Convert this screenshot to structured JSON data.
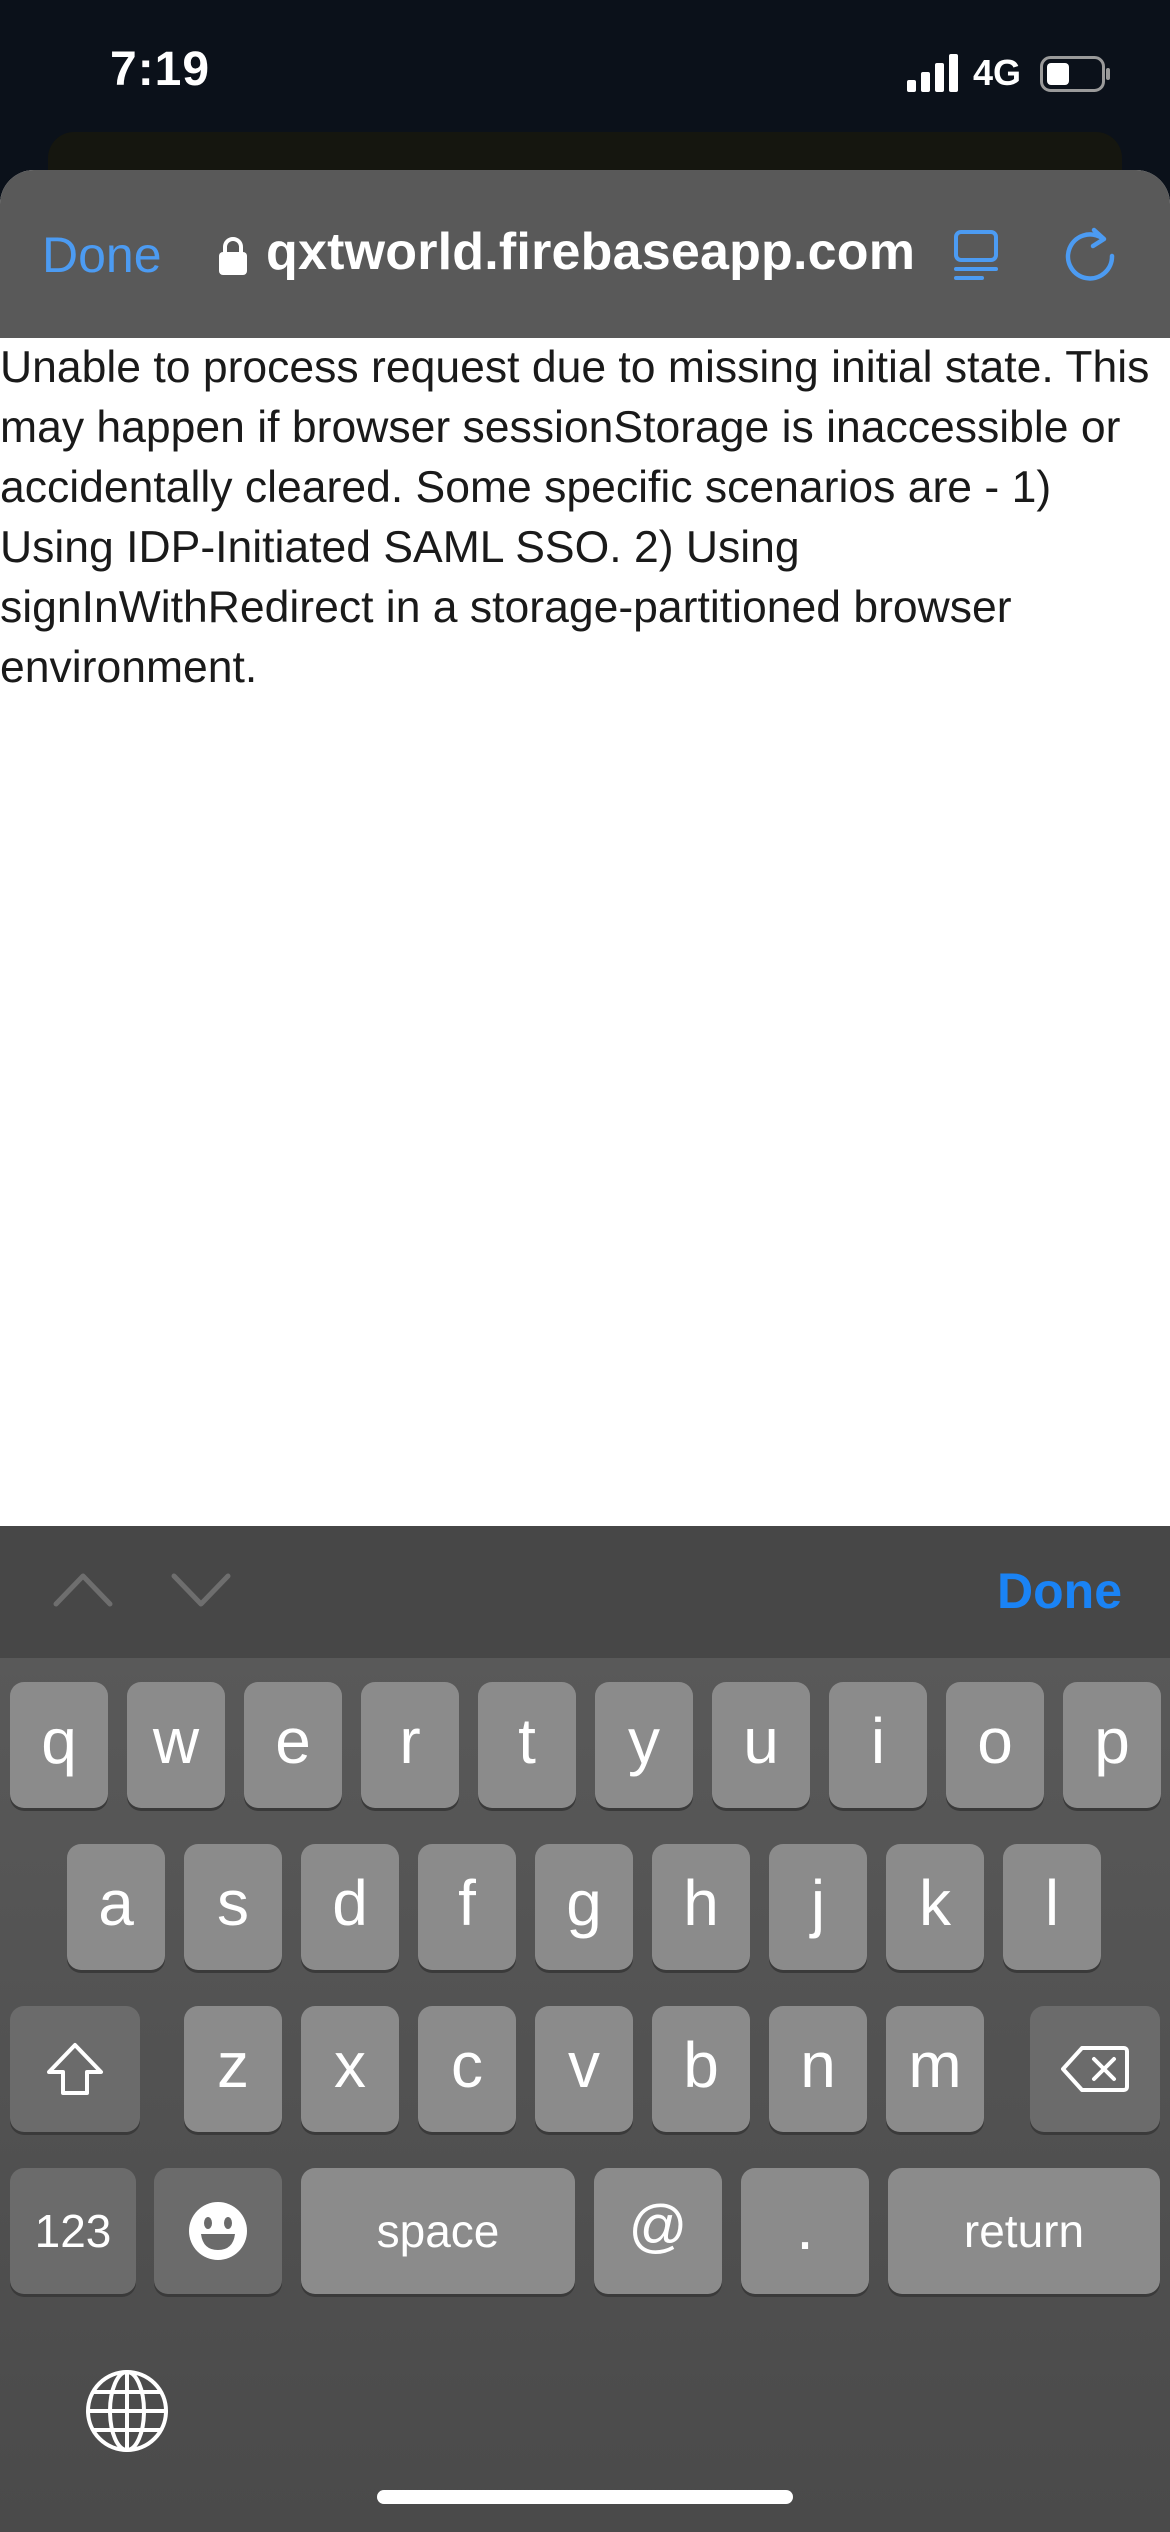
{
  "status_bar": {
    "time": "7:19",
    "network": "4G"
  },
  "browser": {
    "done_label": "Done",
    "url": "qxtworld.firebaseapp.com",
    "accent_color": "#4c9bf2"
  },
  "page": {
    "message": "Unable to process request due to missing initial state. This may happen if browser sessionStorage is inaccessible or accidentally cleared. Some specific scenarios are - 1) Using IDP-Initiated SAML SSO. 2) Using signInWithRedirect in a storage-partitioned browser environment."
  },
  "keyboard": {
    "accessory_done_label": "Done",
    "row1": [
      "q",
      "w",
      "e",
      "r",
      "t",
      "y",
      "u",
      "i",
      "o",
      "p"
    ],
    "row2": [
      "a",
      "s",
      "d",
      "f",
      "g",
      "h",
      "j",
      "k",
      "l"
    ],
    "row3": [
      "z",
      "x",
      "c",
      "v",
      "b",
      "n",
      "m"
    ],
    "numbers_label": "123",
    "space_label": "space",
    "at_label": "@",
    "period_label": ".",
    "return_label": "return"
  }
}
